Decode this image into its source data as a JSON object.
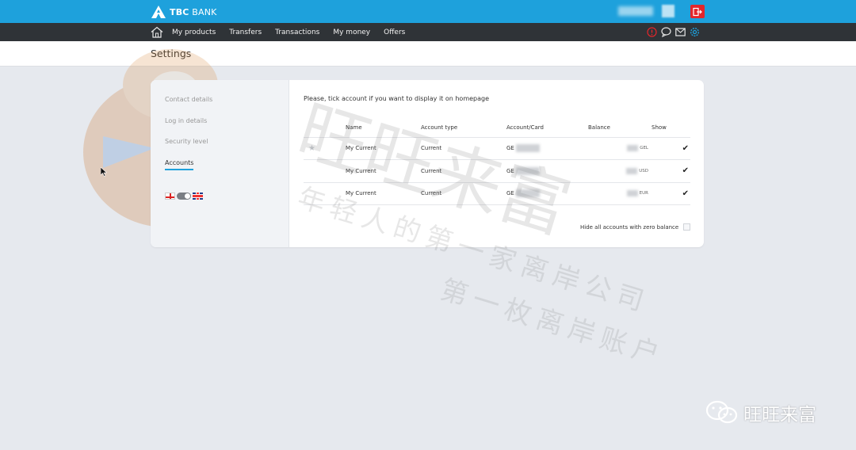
{
  "header": {
    "logo_bold": "TBC",
    "logo_text": "BANK",
    "brand_color": "#1ea1dc",
    "logout_icon": "logout-icon"
  },
  "nav": {
    "items": [
      {
        "label": "My products"
      },
      {
        "label": "Transfers"
      },
      {
        "label": "Transactions"
      },
      {
        "label": "My money"
      },
      {
        "label": "Offers"
      }
    ],
    "icons": [
      "alert-icon",
      "chat-icon",
      "mail-icon",
      "gear-icon"
    ]
  },
  "page": {
    "title": "Settings"
  },
  "sidebar": {
    "items": [
      {
        "label": "Contact details"
      },
      {
        "label": "Log in details"
      },
      {
        "label": "Security level"
      },
      {
        "label": "Accounts"
      }
    ],
    "active_index": 3
  },
  "accounts": {
    "intro": "Please, tick account if you want to display it on homepage",
    "columns": [
      "Name",
      "Account type",
      "Account/Card",
      "Balance",
      "Show"
    ],
    "rows": [
      {
        "name": "My Current",
        "type": "Current",
        "card_prefix": "GE",
        "currency": "GEL",
        "starred": true,
        "show": true
      },
      {
        "name": "My Current",
        "type": "Current",
        "card_prefix": "GE",
        "currency": "USD",
        "starred": false,
        "show": true
      },
      {
        "name": "My Current",
        "type": "Current",
        "card_prefix": "GE",
        "currency": "EUR",
        "starred": false,
        "show": true
      }
    ],
    "hide_zero_label": "Hide all accounts with zero balance",
    "hide_zero_checked": false
  },
  "watermark": {
    "big": "旺旺来富",
    "line1": "年轻人的第一家离岸公司",
    "line2": "第一枚离岸账户",
    "corner": "旺旺来富"
  }
}
